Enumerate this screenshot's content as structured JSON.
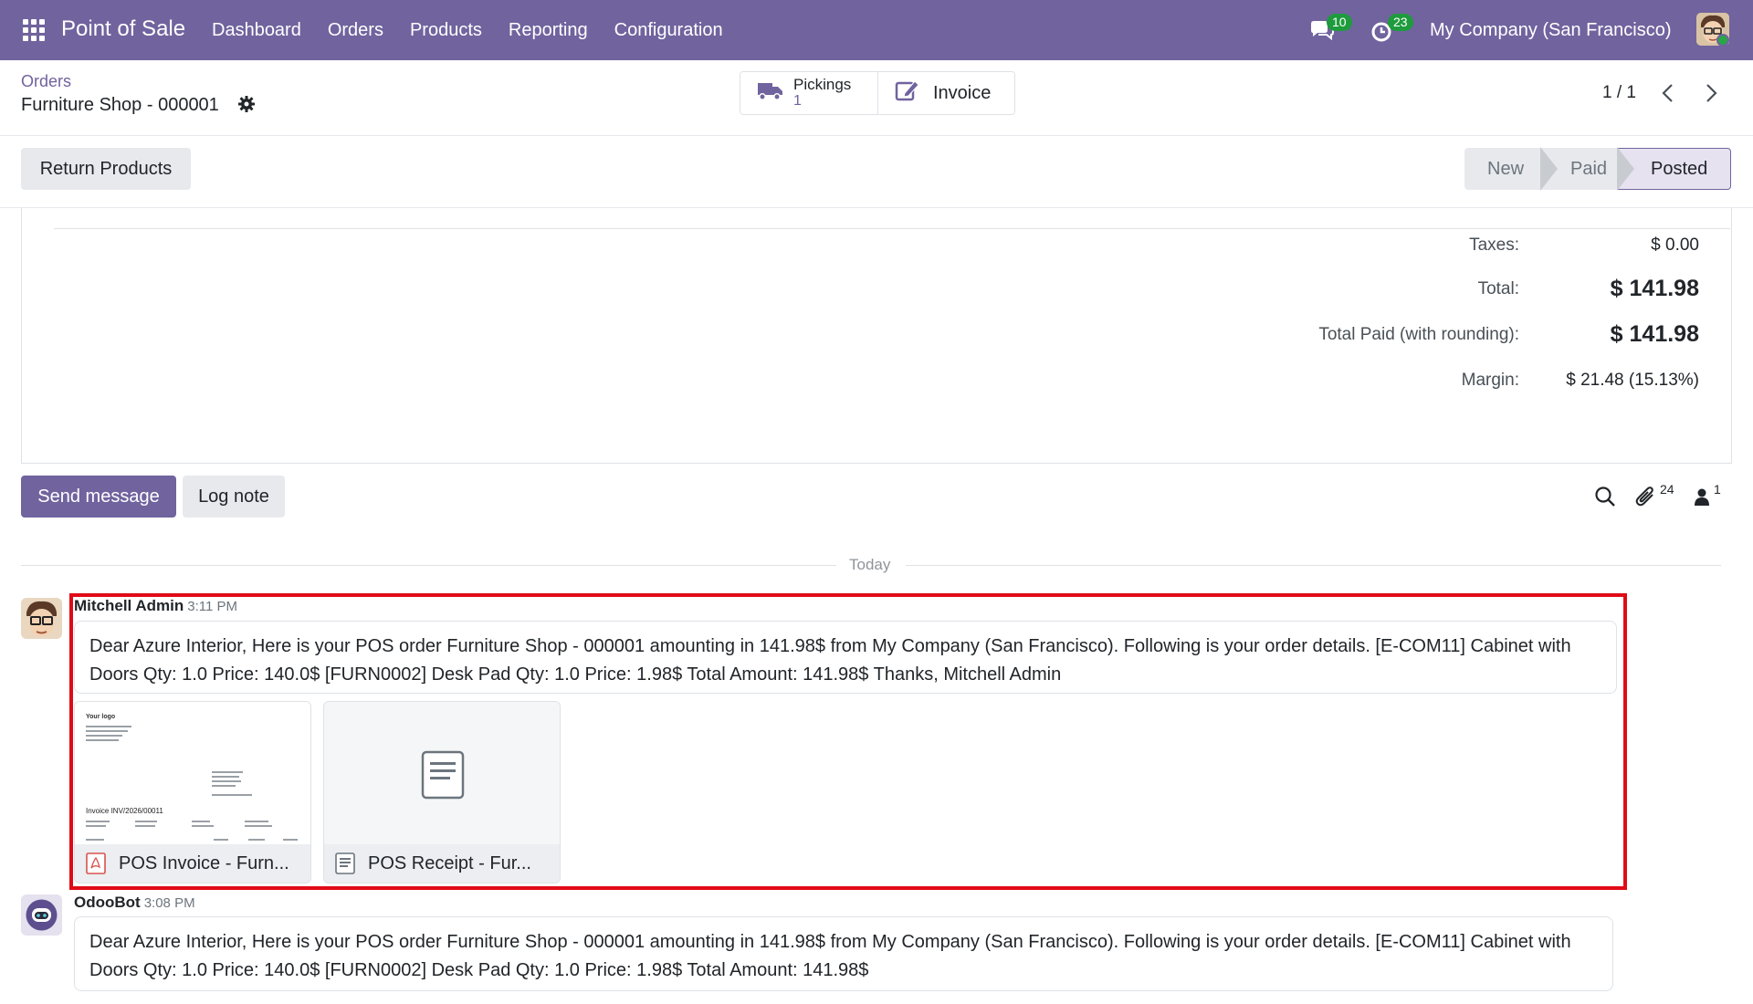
{
  "navbar": {
    "app_name": "Point of Sale",
    "menu": [
      "Dashboard",
      "Orders",
      "Products",
      "Reporting",
      "Configuration"
    ],
    "messages_badge": "10",
    "activities_badge": "23",
    "company": "My Company (San Francisco)"
  },
  "control_panel": {
    "breadcrumb": "Orders",
    "record_name": "Furniture Shop - 000001",
    "pickings_label": "Pickings",
    "pickings_count": "1",
    "invoice_label": "Invoice",
    "pager": "1 / 1"
  },
  "header": {
    "return_button": "Return Products",
    "statuses": [
      "New",
      "Paid",
      "Posted"
    ],
    "active_status": "Posted"
  },
  "totals": {
    "taxes_label": "Taxes:",
    "taxes_value": "$ 0.00",
    "total_label": "Total:",
    "total_value": "$ 141.98",
    "paid_label": "Total Paid (with rounding):",
    "paid_value": "$ 141.98",
    "margin_label": "Margin:",
    "margin_value": "$ 21.48 (15.13%)"
  },
  "chatter": {
    "send_message": "Send message",
    "log_note": "Log note",
    "attachments_count": "24",
    "followers_count": "1",
    "date_separator": "Today",
    "messages": [
      {
        "author": "Mitchell Admin",
        "time": "3:11 PM",
        "body": "Dear Azure Interior, Here is your POS order Furniture Shop - 000001 amounting in 141.98$ from My Company (San Francisco). Following is your order details. [E-COM11] Cabinet with Doors Qty: 1.0 Price: 140.0$ [FURN0002] Desk Pad Qty: 1.0 Price: 1.98$ Total Amount: 141.98$ Thanks, Mitchell Admin",
        "attachments": [
          {
            "name": "POS Invoice - Furn...",
            "type": "pdf"
          },
          {
            "name": "POS Receipt - Fur...",
            "type": "file"
          }
        ]
      },
      {
        "author": "OdooBot",
        "time": "3:08 PM",
        "body": "Dear Azure Interior, Here is your POS order Furniture Shop - 000001 amounting in 141.98$ from My Company (San Francisco). Following is your order details. [E-COM11] Cabinet with Doors Qty: 1.0 Price: 140.0$ [FURN0002] Desk Pad Qty: 1.0 Price: 1.98$ Total Amount: 141.98$"
      }
    ],
    "invoice_thumb": {
      "logo": "Your logo",
      "title": "Invoice INV/2026/00011"
    }
  },
  "colors": {
    "brand": "#71639e",
    "badge": "#1e9b3c",
    "highlight": "#e00b17"
  }
}
